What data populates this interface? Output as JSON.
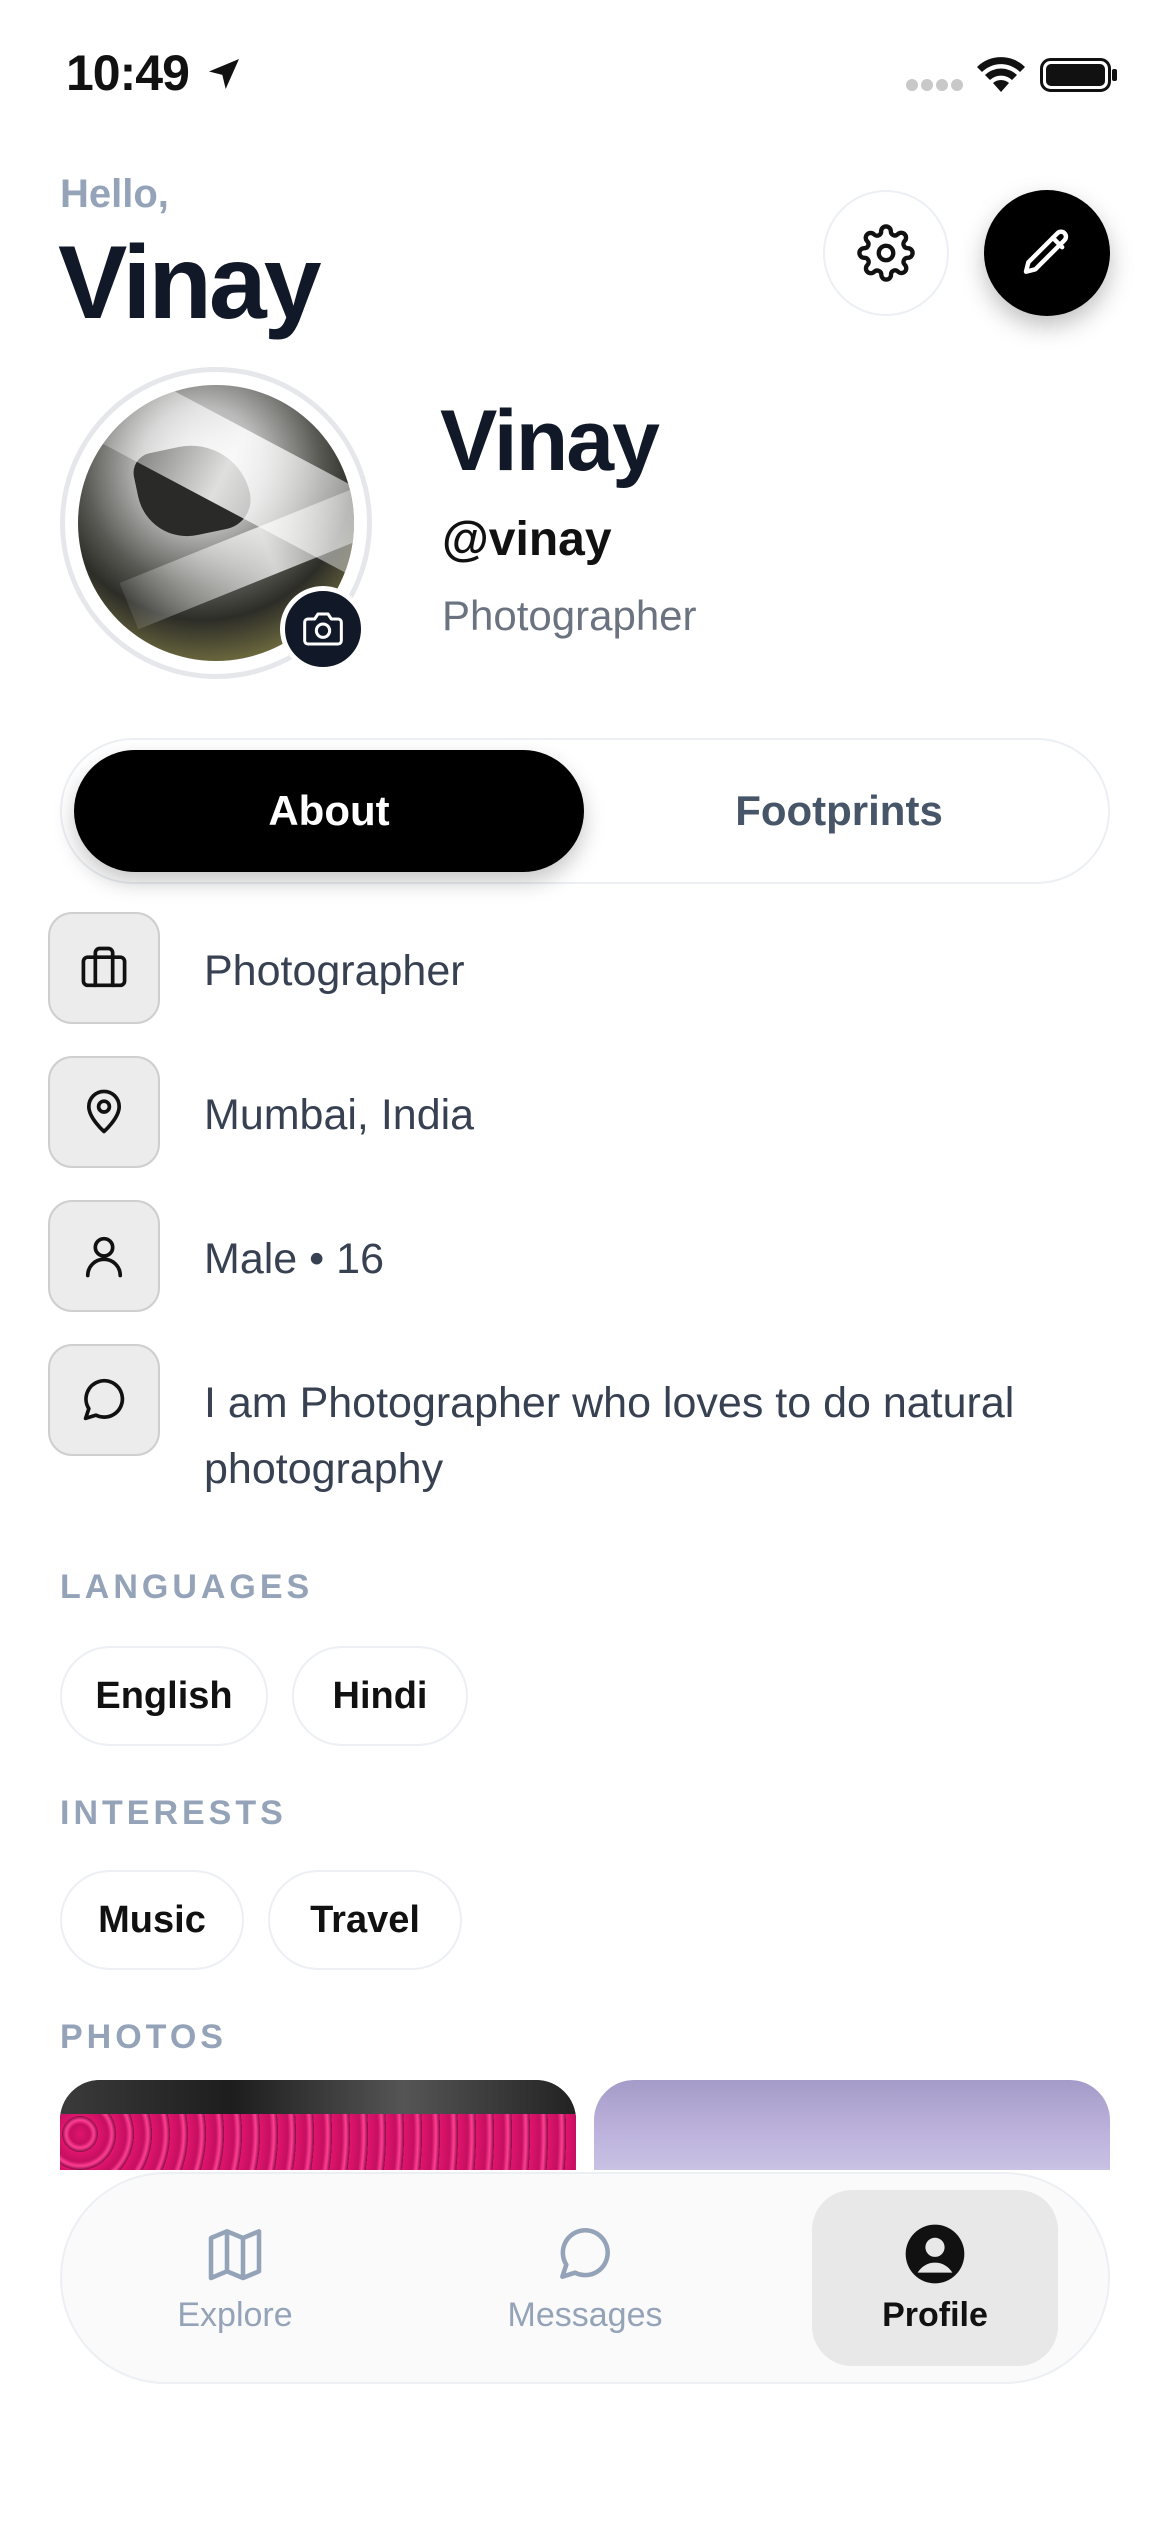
{
  "status_bar": {
    "time": "10:49",
    "icons": [
      "location-arrow-icon",
      "signal-icon",
      "wifi-icon",
      "battery-icon"
    ]
  },
  "header": {
    "greeting": "Hello,",
    "name": "Vinay",
    "settings_icon": "gear-icon",
    "edit_icon": "pencil-icon"
  },
  "profile": {
    "display_name": "Vinay",
    "handle": "@vinay",
    "role": "Photographer",
    "avatar_action_icon": "camera-icon"
  },
  "tabs": [
    {
      "label": "About",
      "active": true
    },
    {
      "label": "Footprints",
      "active": false
    }
  ],
  "about": [
    {
      "icon": "briefcase-icon",
      "text": "Photographer"
    },
    {
      "icon": "map-pin-icon",
      "text": "Mumbai, India"
    },
    {
      "icon": "person-icon",
      "text": "Male • 16"
    },
    {
      "icon": "chat-bubble-icon",
      "text": "I am Photographer who loves to do natural photography"
    }
  ],
  "languages": {
    "label": "LANGUAGES",
    "items": [
      "English",
      "Hindi"
    ]
  },
  "interests": {
    "label": "INTERESTS",
    "items": [
      "Music",
      "Travel"
    ]
  },
  "photos": {
    "label": "PHOTOS"
  },
  "bottom_nav": [
    {
      "label": "Explore",
      "icon": "map-icon",
      "active": false
    },
    {
      "label": "Messages",
      "icon": "chat-bubble-icon",
      "active": false
    },
    {
      "label": "Profile",
      "icon": "user-circle-icon",
      "active": true
    }
  ],
  "colors": {
    "primary": "#000000",
    "text_dark": "#111827",
    "muted": "#94a3b8",
    "chip_border": "#eceff3"
  }
}
